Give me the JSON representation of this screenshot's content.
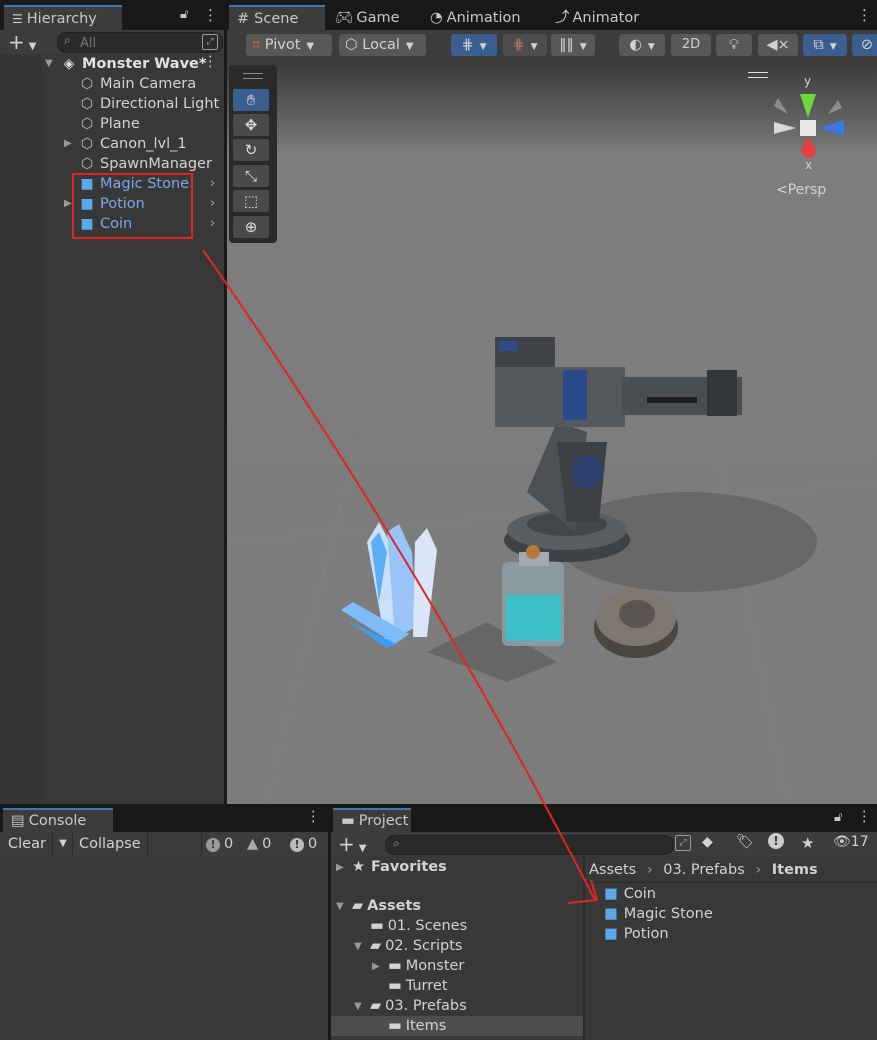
{
  "hierarchy": {
    "tab_label": "Hierarchy",
    "search_placeholder": "All",
    "scene_name": "Monster Wave*",
    "items": [
      {
        "label": "Main Camera",
        "type": "object"
      },
      {
        "label": "Directional Light",
        "type": "object"
      },
      {
        "label": "Plane",
        "type": "object"
      },
      {
        "label": "Canon_lvl_1",
        "type": "object"
      },
      {
        "label": "SpawnManager",
        "type": "object"
      },
      {
        "label": "Magic Stone",
        "type": "prefab"
      },
      {
        "label": "Potion",
        "type": "prefab"
      },
      {
        "label": "Coin",
        "type": "prefab"
      }
    ]
  },
  "scene_tabs": {
    "scene": "Scene",
    "game": "Game",
    "animation": "Animation",
    "animator": "Animator"
  },
  "scene_toolbar": {
    "pivot": "Pivot",
    "local": "Local",
    "mode_2d": "2D"
  },
  "gizmo": {
    "y": "y",
    "x": "x",
    "persp": "Persp"
  },
  "console": {
    "tab_label": "Console",
    "clear": "Clear",
    "collapse": "Collapse",
    "info_count": "0",
    "warn_count": "0",
    "error_count": "0"
  },
  "project": {
    "tab_label": "Project",
    "hidden_count": "17",
    "tree": {
      "favorites": "Favorites",
      "assets": "Assets",
      "scenes": "01. Scenes",
      "scripts": "02. Scripts",
      "monster": "Monster",
      "turret": "Turret",
      "prefabs": "03. Prefabs",
      "items": "Items"
    },
    "breadcrumb": {
      "assets": "Assets",
      "prefabs": "03. Prefabs",
      "items": "Items"
    },
    "files": [
      "Coin",
      "Magic Stone",
      "Potion"
    ]
  },
  "colors": {
    "accent": "#3a79bb",
    "prefab_text": "#7aa7e8",
    "annotation": "#e02424"
  }
}
